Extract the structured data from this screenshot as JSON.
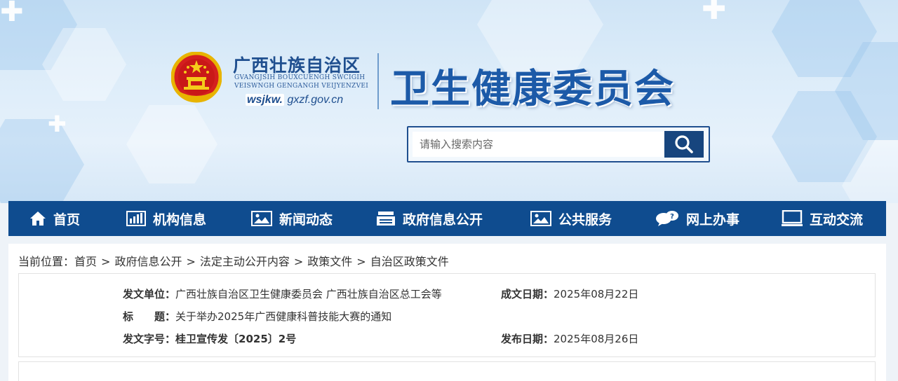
{
  "header": {
    "org_name_cn": "广西壮族自治区",
    "org_name_zhuang_line1": "GVANGJSIH BOUXCUENGH SWCIGIH",
    "org_name_zhuang_line2": "VEISWNGH GENGANGH VEIJYENZVEI",
    "site_url_prefix": "wsjkw.",
    "site_url_domain": "gxzf.gov.cn",
    "dept_title": "卫生健康委员会",
    "emblem_icon": "national-emblem"
  },
  "search": {
    "placeholder": "请输入搜索内容",
    "button_icon": "search-icon"
  },
  "nav": {
    "items": [
      {
        "label": "首页",
        "icon": "home-icon"
      },
      {
        "label": "机构信息",
        "icon": "bar-chart-icon"
      },
      {
        "label": "新闻动态",
        "icon": "image-icon"
      },
      {
        "label": "政府信息公开",
        "icon": "files-icon"
      },
      {
        "label": "公共服务",
        "icon": "image-icon"
      },
      {
        "label": "网上办事",
        "icon": "chat-bubbles-icon"
      },
      {
        "label": "互动交流",
        "icon": "monitor-icon"
      }
    ],
    "background": "#0f4c8f"
  },
  "breadcrumb": {
    "prefix": "当前位置：",
    "items": [
      "首页",
      "政府信息公开",
      "法定主动公开内容",
      "政策文件",
      "自治区政策文件"
    ],
    "separator": ">"
  },
  "document": {
    "issuer_label": "发文单位：",
    "issuer_value": "广西壮族自治区卫生健康委员会 广西壮族自治区总工会等",
    "written_date_label": "成文日期：",
    "written_date_value": "2025年08月22日",
    "title_label": "标　　题：",
    "title_value": "关于举办2025年广西健康科普技能大赛的通知",
    "doc_no_label": "发文字号：",
    "doc_no_value": "桂卫宣传发〔2025〕2号",
    "publish_date_label": "发布日期：",
    "publish_date_value": "2025年08月26日"
  },
  "colors": {
    "brand_blue": "#1c5aa8",
    "nav_blue": "#0f4c8f",
    "text": "#333333"
  }
}
